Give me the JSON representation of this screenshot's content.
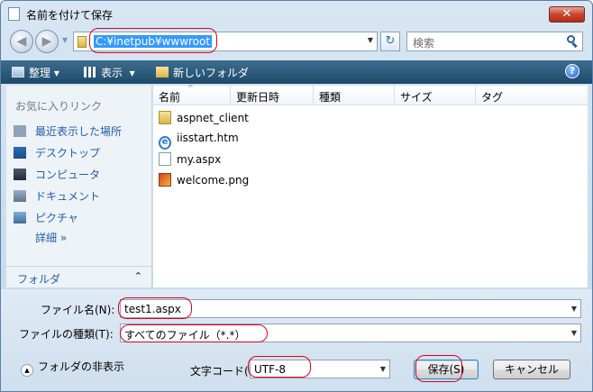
{
  "window": {
    "title": "名前を付けて保存",
    "close_label": "✕"
  },
  "address": {
    "path": "C:¥inetpub¥wwwroot",
    "search_placeholder": "検索"
  },
  "toolbar": {
    "organize": "整理",
    "views": "表示",
    "new_folder": "新しいフォルダ",
    "help": "?"
  },
  "nav": {
    "header": "お気に入りリンク",
    "items": [
      {
        "label": "最近表示した場所",
        "icon": "recent-places-icon"
      },
      {
        "label": "デスクトップ",
        "icon": "desktop-icon"
      },
      {
        "label": "コンピュータ",
        "icon": "computer-icon"
      },
      {
        "label": "ドキュメント",
        "icon": "documents-icon"
      },
      {
        "label": "ピクチャ",
        "icon": "pictures-icon"
      }
    ],
    "more": "詳細 »",
    "folders": "フォルダ"
  },
  "columns": [
    "名前",
    "更新日時",
    "種類",
    "サイズ",
    "タグ"
  ],
  "files": [
    {
      "name": "aspnet_client",
      "type": "folder"
    },
    {
      "name": "iisstart.htm",
      "type": "html"
    },
    {
      "name": "my.aspx",
      "type": "document"
    },
    {
      "name": "welcome.png",
      "type": "image"
    }
  ],
  "form": {
    "filename_label": "ファイル名(N):",
    "filename_value": "test1.aspx",
    "filetype_label": "ファイルの種類(T):",
    "filetype_value": "すべてのファイル（*.*）",
    "encoding_label": "文字コード(E)",
    "encoding_value": "UTF-8",
    "hide_folders": "フォルダの非表示",
    "save": "保存(S)",
    "cancel": "キャンセル"
  },
  "colors": {
    "toolbar": "#1f4a69",
    "link": "#1f5fa8",
    "highlight": "#e0001a",
    "selection": "#3399ff"
  }
}
